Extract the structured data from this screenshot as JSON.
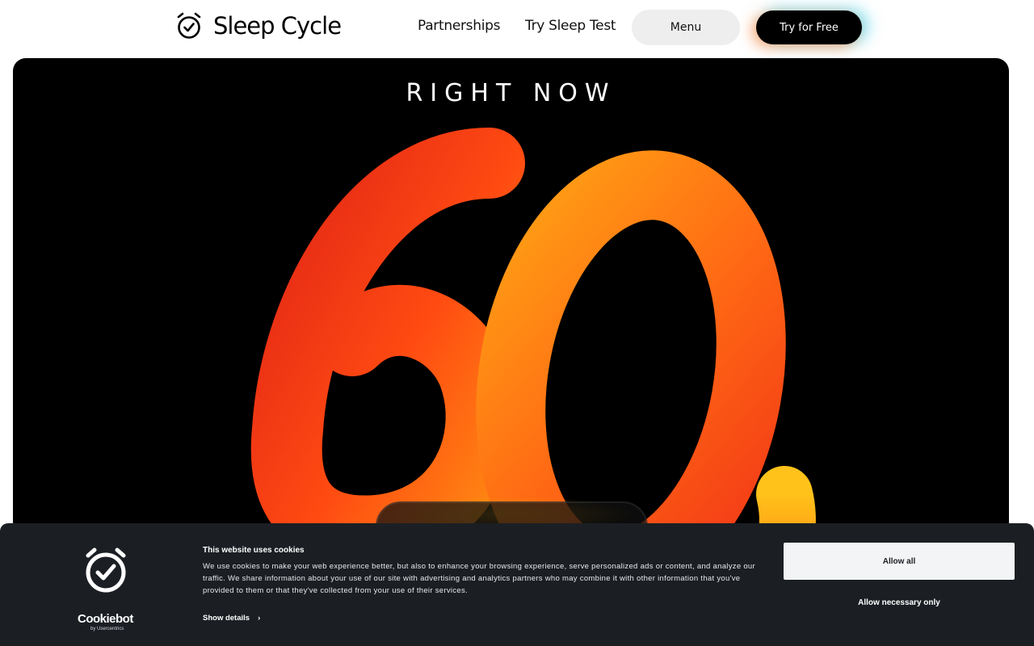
{
  "header": {
    "brand": "Sleep Cycle",
    "nav": {
      "partnerships": "Partnerships",
      "sleep_test": "Try Sleep Test"
    },
    "menu_label": "Menu",
    "cta_label": "Try for Free",
    "logo_icon": "alarm-clock-check-icon"
  },
  "hero": {
    "kicker": "RIGHT NOW",
    "art_text": "60,",
    "art_colors": {
      "red": "#e8251a",
      "orange": "#ff7a10",
      "yellow": "#ffc21a"
    }
  },
  "cookie_banner": {
    "title": "This website uses cookies",
    "body": "We use cookies to make your web experience better, but also to enhance your browsing experience, serve personalized ads or content, and analyze our traffic. We share information about your use of our site with advertising and analytics partners who may combine it with other information that you've provided to them or that they've collected from your use of their services.",
    "show_details": "Show details",
    "allow_all": "Allow all",
    "allow_necessary": "Allow necessary only",
    "brand": "Cookiebot",
    "brand_sub": "by Usercentrics"
  }
}
